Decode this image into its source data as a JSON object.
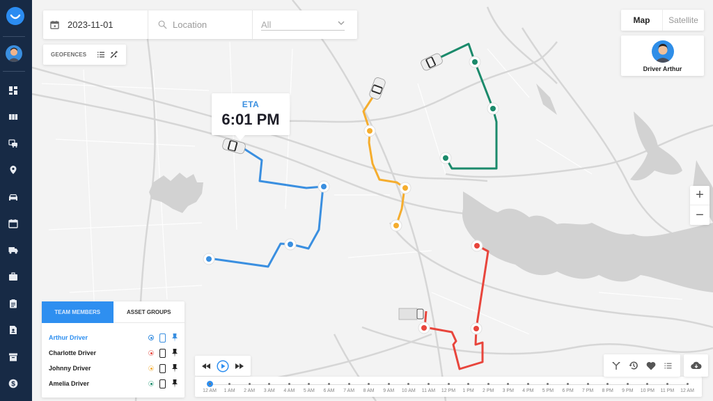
{
  "sidebar": {
    "logo": "smile-logo-icon",
    "items": [
      {
        "icon": "dashboard-icon"
      },
      {
        "icon": "columns-icon"
      },
      {
        "icon": "vehicles-icon"
      },
      {
        "icon": "location-pin-icon"
      },
      {
        "icon": "car-icon"
      },
      {
        "icon": "calendar-icon"
      },
      {
        "icon": "truck-icon"
      },
      {
        "icon": "briefcase-icon"
      },
      {
        "icon": "clipboard-icon"
      },
      {
        "icon": "contact-document-icon"
      },
      {
        "icon": "archive-icon"
      },
      {
        "icon": "dollar-icon"
      }
    ]
  },
  "filters": {
    "date": "2023-11-01",
    "location_placeholder": "Location",
    "group_select": "All"
  },
  "geofences": {
    "label": "GEOFENCES"
  },
  "map_type": {
    "options": [
      "Map",
      "Satellite"
    ],
    "selected": "Map"
  },
  "driver_card": {
    "name": "Driver Arthur"
  },
  "zoom": {
    "in": "+",
    "out": "−"
  },
  "eta": {
    "label": "ETA",
    "time": "6:01 PM"
  },
  "team_panel": {
    "tabs": [
      {
        "label": "TEAM MEMBERS",
        "active": true
      },
      {
        "label": "ASSET GROUPS",
        "active": false
      }
    ],
    "members": [
      {
        "name": "Arthur Driver",
        "color": "#3a8fe0",
        "selected": true
      },
      {
        "name": "Charlotte Driver",
        "color": "#e8453c",
        "selected": false
      },
      {
        "name": "Johnny Driver",
        "color": "#f5ad2e",
        "selected": false
      },
      {
        "name": "Amelia Driver",
        "color": "#1b8a6b",
        "selected": false
      }
    ]
  },
  "routes": [
    {
      "driver": "Arthur Driver",
      "color": "#3a8fe0"
    },
    {
      "driver": "Johnny Driver",
      "color": "#f5ad2e"
    },
    {
      "driver": "Amelia Driver",
      "color": "#1b8a6b"
    },
    {
      "driver": "Charlotte Driver",
      "color": "#e8453c"
    }
  ],
  "playback": {
    "rewind": "rewind-icon",
    "play": "play-icon",
    "forward": "fast-forward-icon"
  },
  "timeline": {
    "labels": [
      "12 AM",
      "1 AM",
      "2 AM",
      "3 AM",
      "4 AM",
      "5 AM",
      "6 AM",
      "7 AM",
      "8 AM",
      "9 AM",
      "10 AM",
      "11 AM",
      "12 PM",
      "1 PM",
      "2 PM",
      "3 PM",
      "4 PM",
      "5 PM",
      "6 PM",
      "7 PM",
      "8 PM",
      "9 PM",
      "10 PM",
      "11 PM",
      "12 AM"
    ],
    "position": 0
  },
  "tools": [
    "split-route-icon",
    "history-icon",
    "favorite-heart-icon",
    "list-icon",
    "cloud-download-icon"
  ]
}
